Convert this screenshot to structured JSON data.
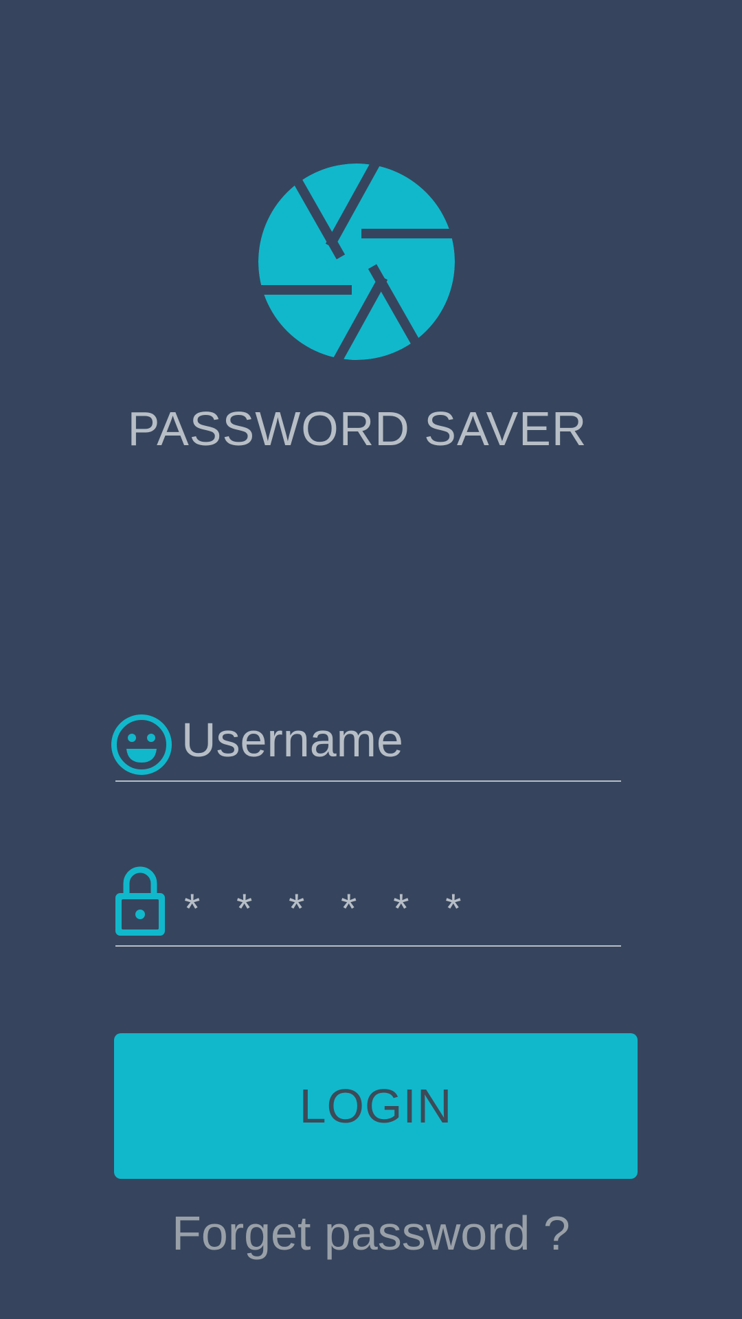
{
  "app": {
    "title": "PASSWORD SAVER",
    "logo_icon": "camera-aperture-icon"
  },
  "form": {
    "username": {
      "icon": "smiley-icon",
      "placeholder": "Username",
      "value": ""
    },
    "password": {
      "icon": "lock-icon",
      "display": "* * * * * *"
    },
    "login_label": "LOGIN",
    "forgot_label": "Forget password ?"
  },
  "colors": {
    "background": "#36455d",
    "accent": "#11b8cc",
    "text": "#b8bec6",
    "button_text": "#3d4a57"
  }
}
